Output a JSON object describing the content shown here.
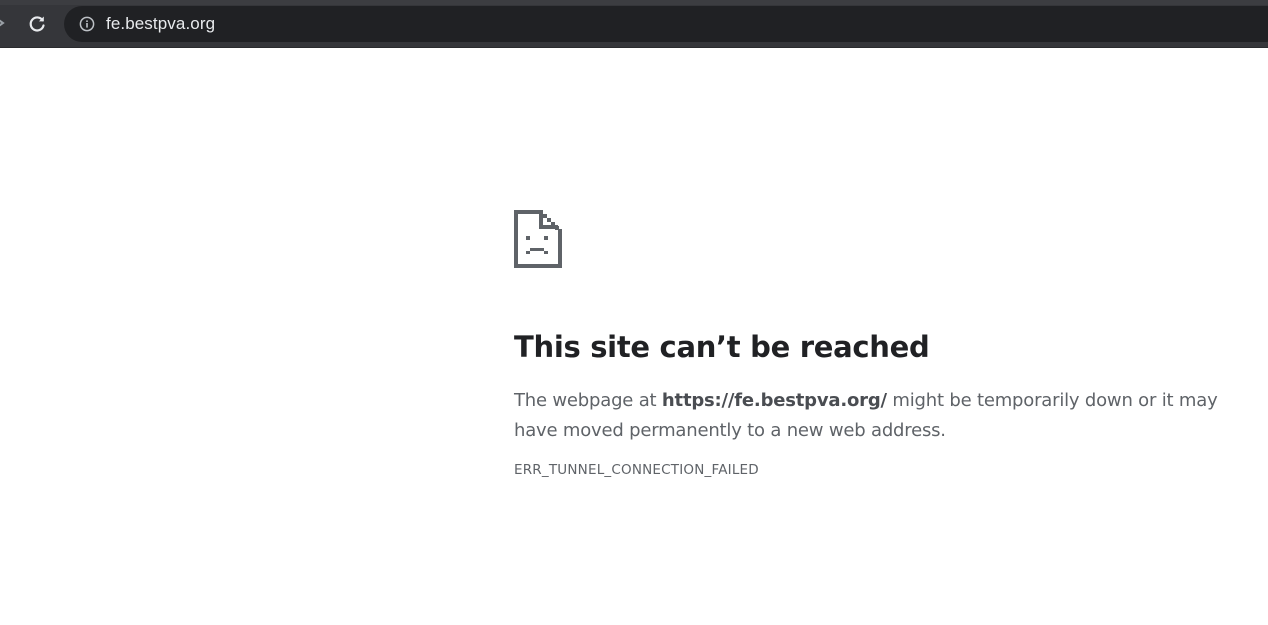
{
  "browser": {
    "omnibox": {
      "url": "fe.bestpva.org"
    }
  },
  "error_page": {
    "title": "This site can’t be reached",
    "message_prefix": "The webpage at ",
    "message_url": "https://fe.bestpva.org/",
    "message_suffix": " might be temporarily down or it may have moved permanently to a new web address.",
    "error_code": "ERR_TUNNEL_CONNECTION_FAILED",
    "icon": "sad-page-icon"
  },
  "colors": {
    "toolbar_bg": "#35363a",
    "omnibox_bg": "#202124",
    "url_text": "#e8eaed",
    "heading_text": "#202124",
    "body_text": "#5f6368"
  }
}
